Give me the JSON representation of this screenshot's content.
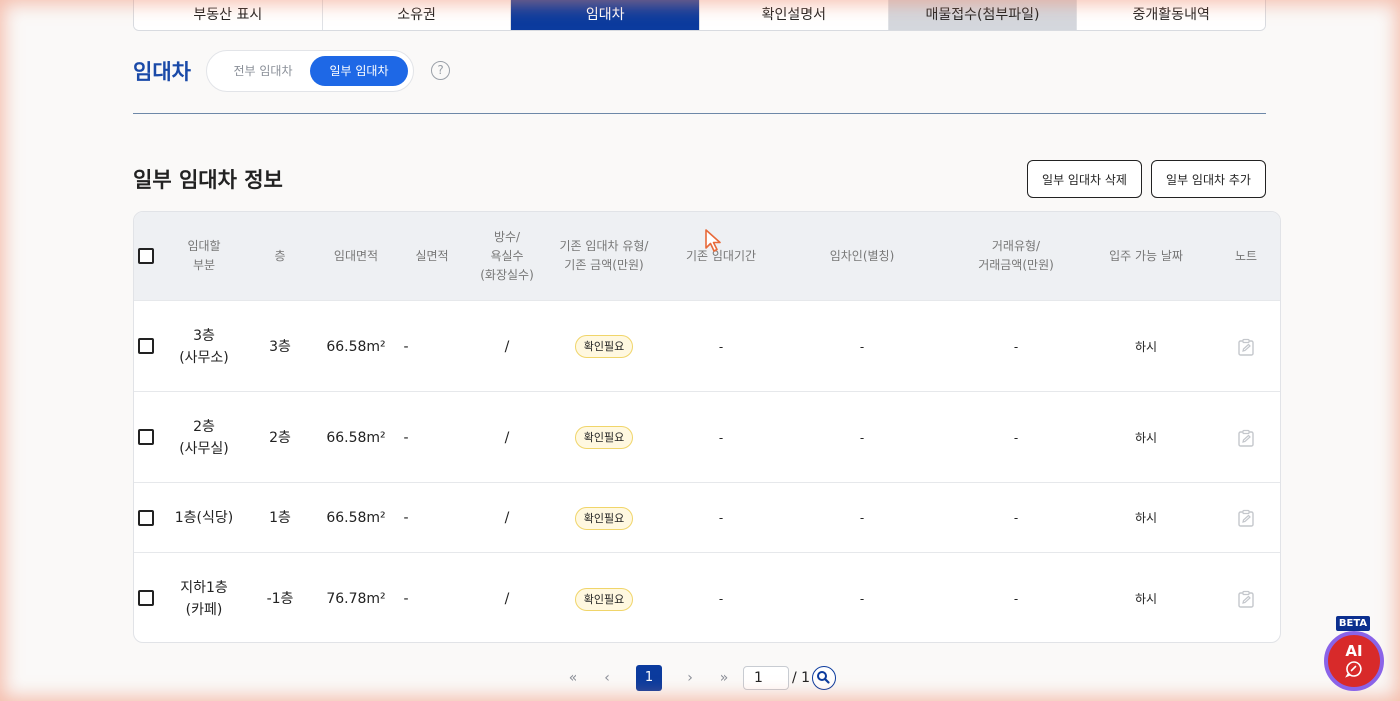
{
  "tabs": [
    {
      "label": "부동산 표시"
    },
    {
      "label": "소유권"
    },
    {
      "label": "임대차"
    },
    {
      "label": "확인설명서"
    },
    {
      "label": "매물접수(첨부파일)"
    },
    {
      "label": "중개활동내역"
    }
  ],
  "lease_section": {
    "title": "임대차",
    "toggle_all": "전부 임대차",
    "toggle_partial": "일부 임대차",
    "help_label": "?"
  },
  "partial_info": {
    "title": "일부 임대차 정보",
    "delete_button": "일부 임대차 삭제",
    "add_button": "일부 임대차 추가"
  },
  "table": {
    "headers": {
      "part": "임대할\n부분",
      "floor": "층",
      "lease_area": "임대면적",
      "real_area": "실면적",
      "rooms": "방수/\n욕실수\n(화장실수)",
      "existing": "기존 임대차 유형/\n기존 금액(만원)",
      "period": "기존 임대기간",
      "tenant": "임차인(별칭)",
      "deal": "거래유형/\n거래금액(만원)",
      "move_in": "입주 가능 날짜",
      "note": "노트"
    },
    "rows": [
      {
        "part": "3층\n(사무소)",
        "floor": "3층",
        "lease_area": "66.58m²",
        "real_area": "-",
        "rooms": "/",
        "existing": "확인필요",
        "period": "-",
        "tenant": "-",
        "deal": "-",
        "move_in": "하시"
      },
      {
        "part": "2층\n(사무실)",
        "floor": "2층",
        "lease_area": "66.58m²",
        "real_area": "-",
        "rooms": "/",
        "existing": "확인필요",
        "period": "-",
        "tenant": "-",
        "deal": "-",
        "move_in": "하시"
      },
      {
        "part": "1층(식당)",
        "floor": "1층",
        "lease_area": "66.58m²",
        "real_area": "-",
        "rooms": "/",
        "existing": "확인필요",
        "period": "-",
        "tenant": "-",
        "deal": "-",
        "move_in": "하시"
      },
      {
        "part": "지하1층\n(카페)",
        "floor": "-1층",
        "lease_area": "76.78m²",
        "real_area": "-",
        "rooms": "/",
        "existing": "확인필요",
        "period": "-",
        "tenant": "-",
        "deal": "-",
        "move_in": "하시"
      }
    ]
  },
  "pagination": {
    "first": "«",
    "prev": "‹",
    "current": "1",
    "next": "›",
    "last": "»",
    "input_value": "1",
    "total": "/ 1"
  },
  "ai_assistant": {
    "badge": "BETA",
    "label": "AI"
  },
  "colors": {
    "primary": "#0b3b9e",
    "toggle_active": "#1e68e6",
    "badge_bg": "#fff8e0",
    "ai_red": "#d82a2a"
  }
}
